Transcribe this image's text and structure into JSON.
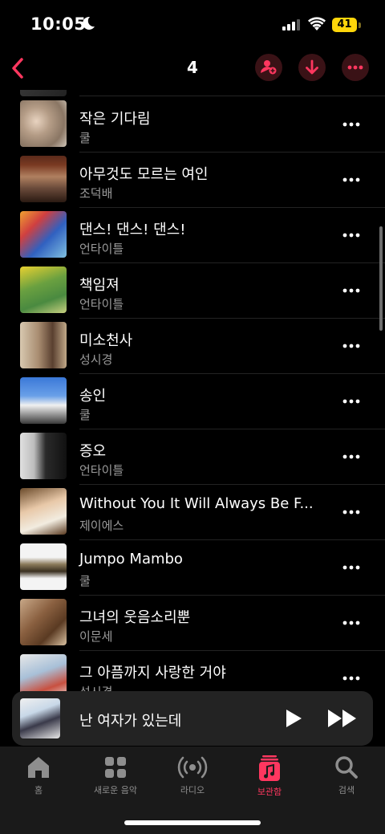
{
  "status_bar": {
    "time": "10:05",
    "battery": "41"
  },
  "nav": {
    "title": "4"
  },
  "songs": [
    {
      "title": "작은 기다림",
      "artist": "쿨"
    },
    {
      "title": "아무것도 모르는 여인",
      "artist": "조덕배"
    },
    {
      "title": "댄스! 댄스! 댄스!",
      "artist": "언타이틀"
    },
    {
      "title": "책임져",
      "artist": "언타이틀"
    },
    {
      "title": "미소천사",
      "artist": "성시경"
    },
    {
      "title": "송인",
      "artist": "쿨"
    },
    {
      "title": "증오",
      "artist": "언타이틀"
    },
    {
      "title": "Without You It Will Always Be F...",
      "artist": "제이에스"
    },
    {
      "title": "Jumpo Mambo",
      "artist": "쿨"
    },
    {
      "title": "그녀의 웃음소리뿐",
      "artist": "이문세"
    },
    {
      "title": "그 아픔까지 사랑한 거야",
      "artist": "성시경"
    }
  ],
  "mini_player": {
    "title": "난 여자가 있는데"
  },
  "tabs": [
    {
      "label": "홈",
      "icon": "home-icon"
    },
    {
      "label": "새로운 음악",
      "icon": "grid-icon"
    },
    {
      "label": "라디오",
      "icon": "radio-icon"
    },
    {
      "label": "보관함",
      "icon": "library-icon",
      "active": true
    },
    {
      "label": "검색",
      "icon": "search-icon"
    }
  ],
  "colors": {
    "accent": "#ff375f",
    "background": "#000000",
    "secondary_text": "#9a9a9a"
  }
}
